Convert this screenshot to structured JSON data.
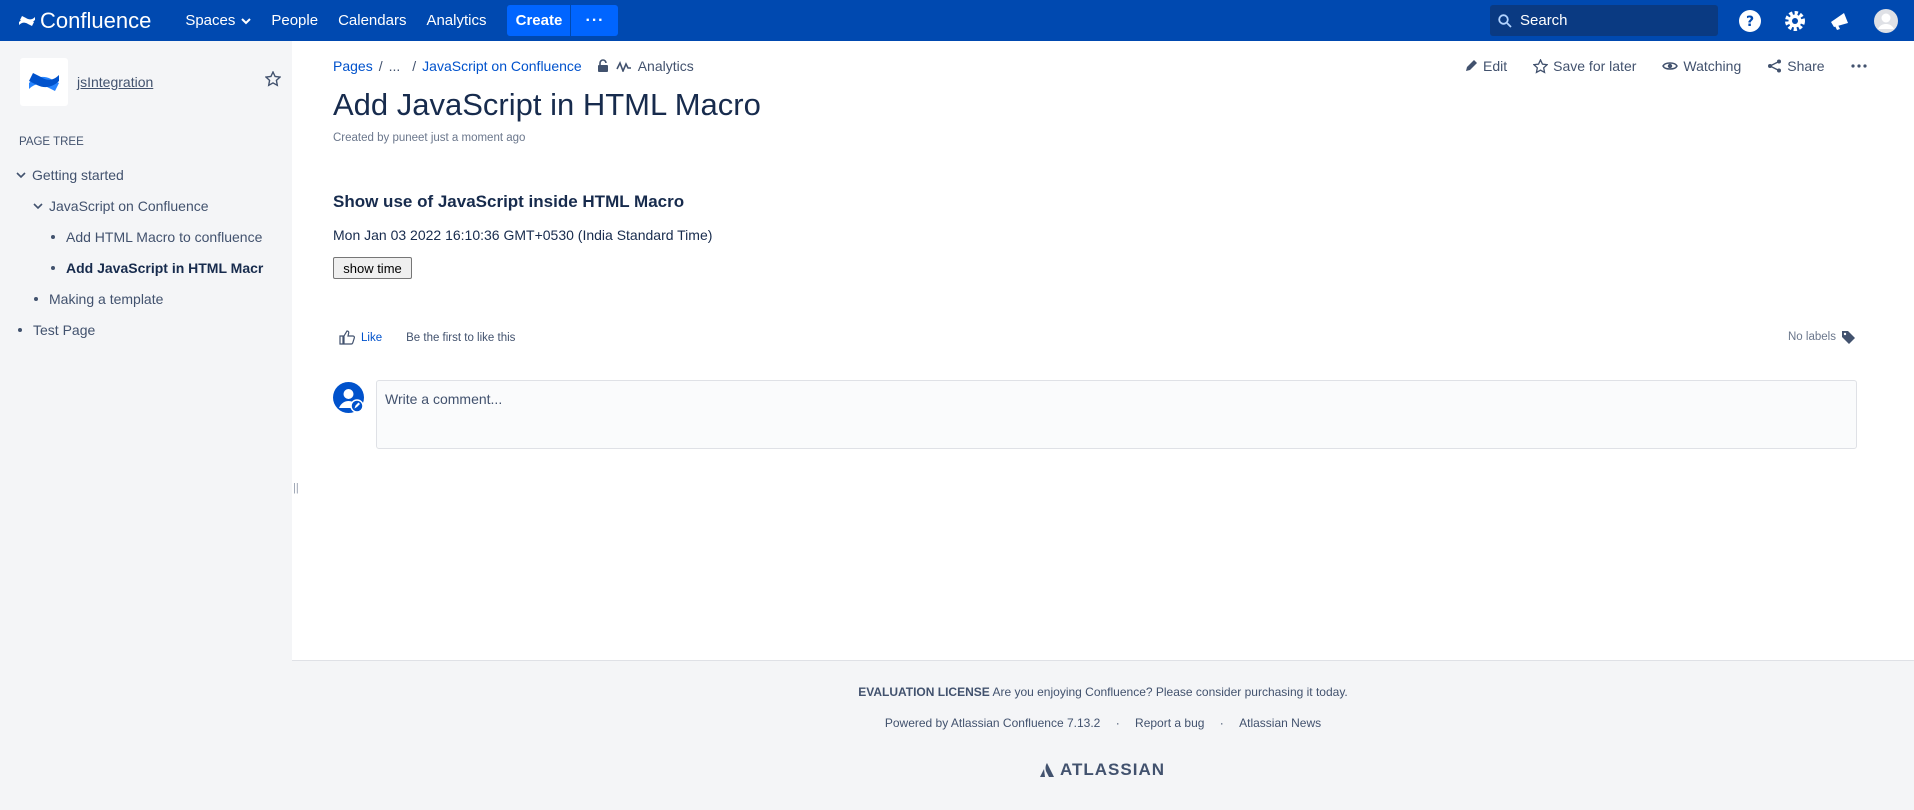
{
  "topnav": {
    "product": "Confluence",
    "spaces": "Spaces",
    "people": "People",
    "calendars": "Calendars",
    "analytics": "Analytics",
    "create": "Create",
    "more": "···",
    "search_placeholder": "Search"
  },
  "sidebar": {
    "space_name": "jsIntegration",
    "page_tree_label": "PAGE TREE",
    "tree": [
      {
        "label": "Getting started"
      },
      {
        "label": "JavaScript on Confluence"
      },
      {
        "label": "Add HTML Macro to confluence"
      },
      {
        "label": "Add JavaScript in HTML Macr"
      },
      {
        "label": "Making a template"
      },
      {
        "label": "Test Page"
      }
    ]
  },
  "breadcrumb": {
    "pages": "Pages",
    "ellipsis": "...",
    "parent": "JavaScript on Confluence",
    "analytics": "Analytics"
  },
  "actions": {
    "edit": "Edit",
    "save_for_later": "Save for later",
    "watching": "Watching",
    "share": "Share"
  },
  "page": {
    "title": "Add JavaScript in HTML Macro",
    "byline": "Created by puneet just a moment ago",
    "heading": "Show use of JavaScript inside HTML Macro",
    "time_text": "Mon Jan 03 2022 16:10:36 GMT+0530 (India Standard Time)",
    "show_time_button": "show time",
    "like": "Like",
    "like_prompt": "Be the first to like this",
    "no_labels": "No labels",
    "comment_placeholder": "Write a comment..."
  },
  "footer": {
    "license_bold": "EVALUATION LICENSE",
    "license_text": "Are you enjoying Confluence? Please consider purchasing it today.",
    "powered_by": "Powered by Atlassian Confluence 7.13.2",
    "dot": "·",
    "report_bug": "Report a bug",
    "news": "Atlassian News",
    "brand": "ATLASSIAN"
  },
  "colors": {
    "topbar": "#0049b0",
    "create": "#0065ff",
    "link": "#0052cc",
    "sidebar_bg": "#f4f5f7"
  }
}
